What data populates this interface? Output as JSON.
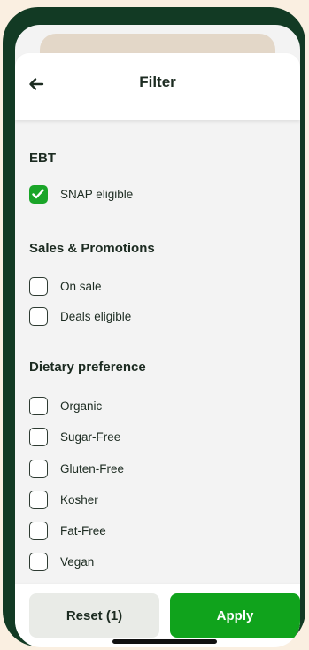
{
  "header": {
    "title": "Filter",
    "back_icon": "arrow-left-icon"
  },
  "sections": [
    {
      "title": "EBT",
      "options": [
        {
          "label": "SNAP eligible",
          "checked": true
        }
      ]
    },
    {
      "title": "Sales & Promotions",
      "options": [
        {
          "label": "On sale",
          "checked": false
        },
        {
          "label": "Deals eligible",
          "checked": false
        }
      ]
    },
    {
      "title": "Dietary preference",
      "options": [
        {
          "label": "Organic",
          "checked": false
        },
        {
          "label": "Sugar-Free",
          "checked": false
        },
        {
          "label": "Gluten-Free",
          "checked": false
        },
        {
          "label": "Kosher",
          "checked": false
        },
        {
          "label": "Fat-Free",
          "checked": false
        },
        {
          "label": "Vegan",
          "checked": false
        }
      ]
    }
  ],
  "footer": {
    "reset_label": "Reset (1)",
    "apply_label": "Apply"
  },
  "colors": {
    "accent": "#1aa528",
    "apply_button": "#10a31c",
    "frame": "#123a24",
    "page_background": "#faefe1"
  }
}
